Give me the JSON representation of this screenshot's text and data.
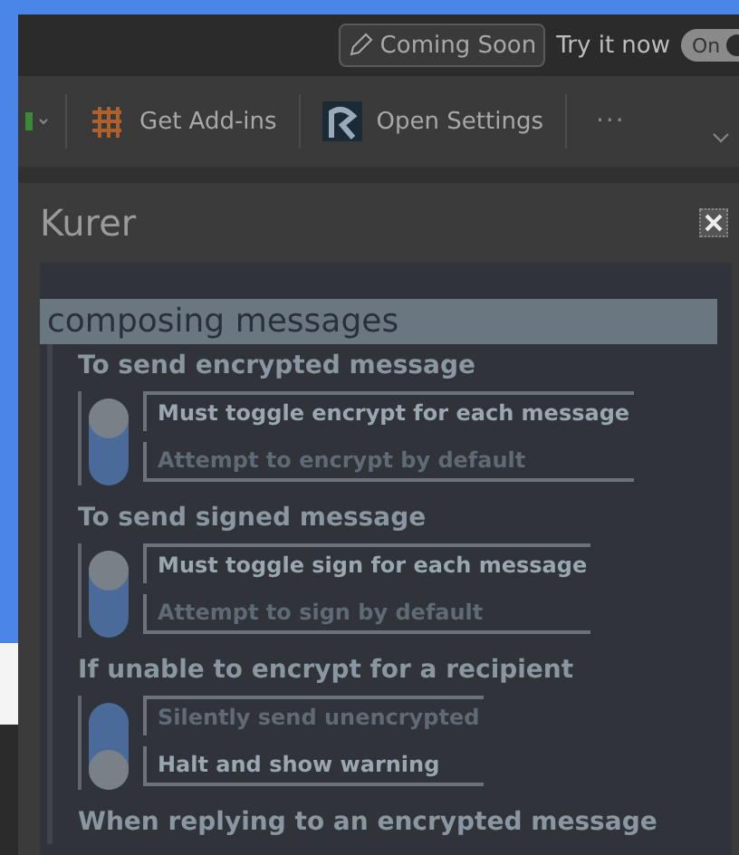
{
  "top_bar": {
    "coming_soon": "Coming Soon",
    "try_label": "Try it now",
    "try_toggle": {
      "label": "On",
      "on": true
    }
  },
  "ribbon": {
    "items": [
      {
        "kind": "addins",
        "label": "Get Add-ins"
      },
      {
        "kind": "settings",
        "label": "Open Settings"
      }
    ],
    "more": "···"
  },
  "dialog": {
    "title": "Kurer",
    "section": "composing messages",
    "groups": [
      {
        "heading": "To send encrypted message",
        "options": [
          {
            "label": "Must toggle encrypt for each message",
            "selected": true
          },
          {
            "label": "Attempt to encrypt by default",
            "selected": false
          }
        ]
      },
      {
        "heading": "To send signed message",
        "options": [
          {
            "label": "Must toggle sign for each message",
            "selected": true
          },
          {
            "label": "Attempt to sign by default",
            "selected": false
          }
        ]
      },
      {
        "heading": "If unable to encrypt for a recipient",
        "options": [
          {
            "label": "Silently send unencrypted",
            "selected": false
          },
          {
            "label": "Halt and show warning",
            "selected": true
          }
        ]
      }
    ],
    "next_heading": "When replying to an encrypted message"
  }
}
